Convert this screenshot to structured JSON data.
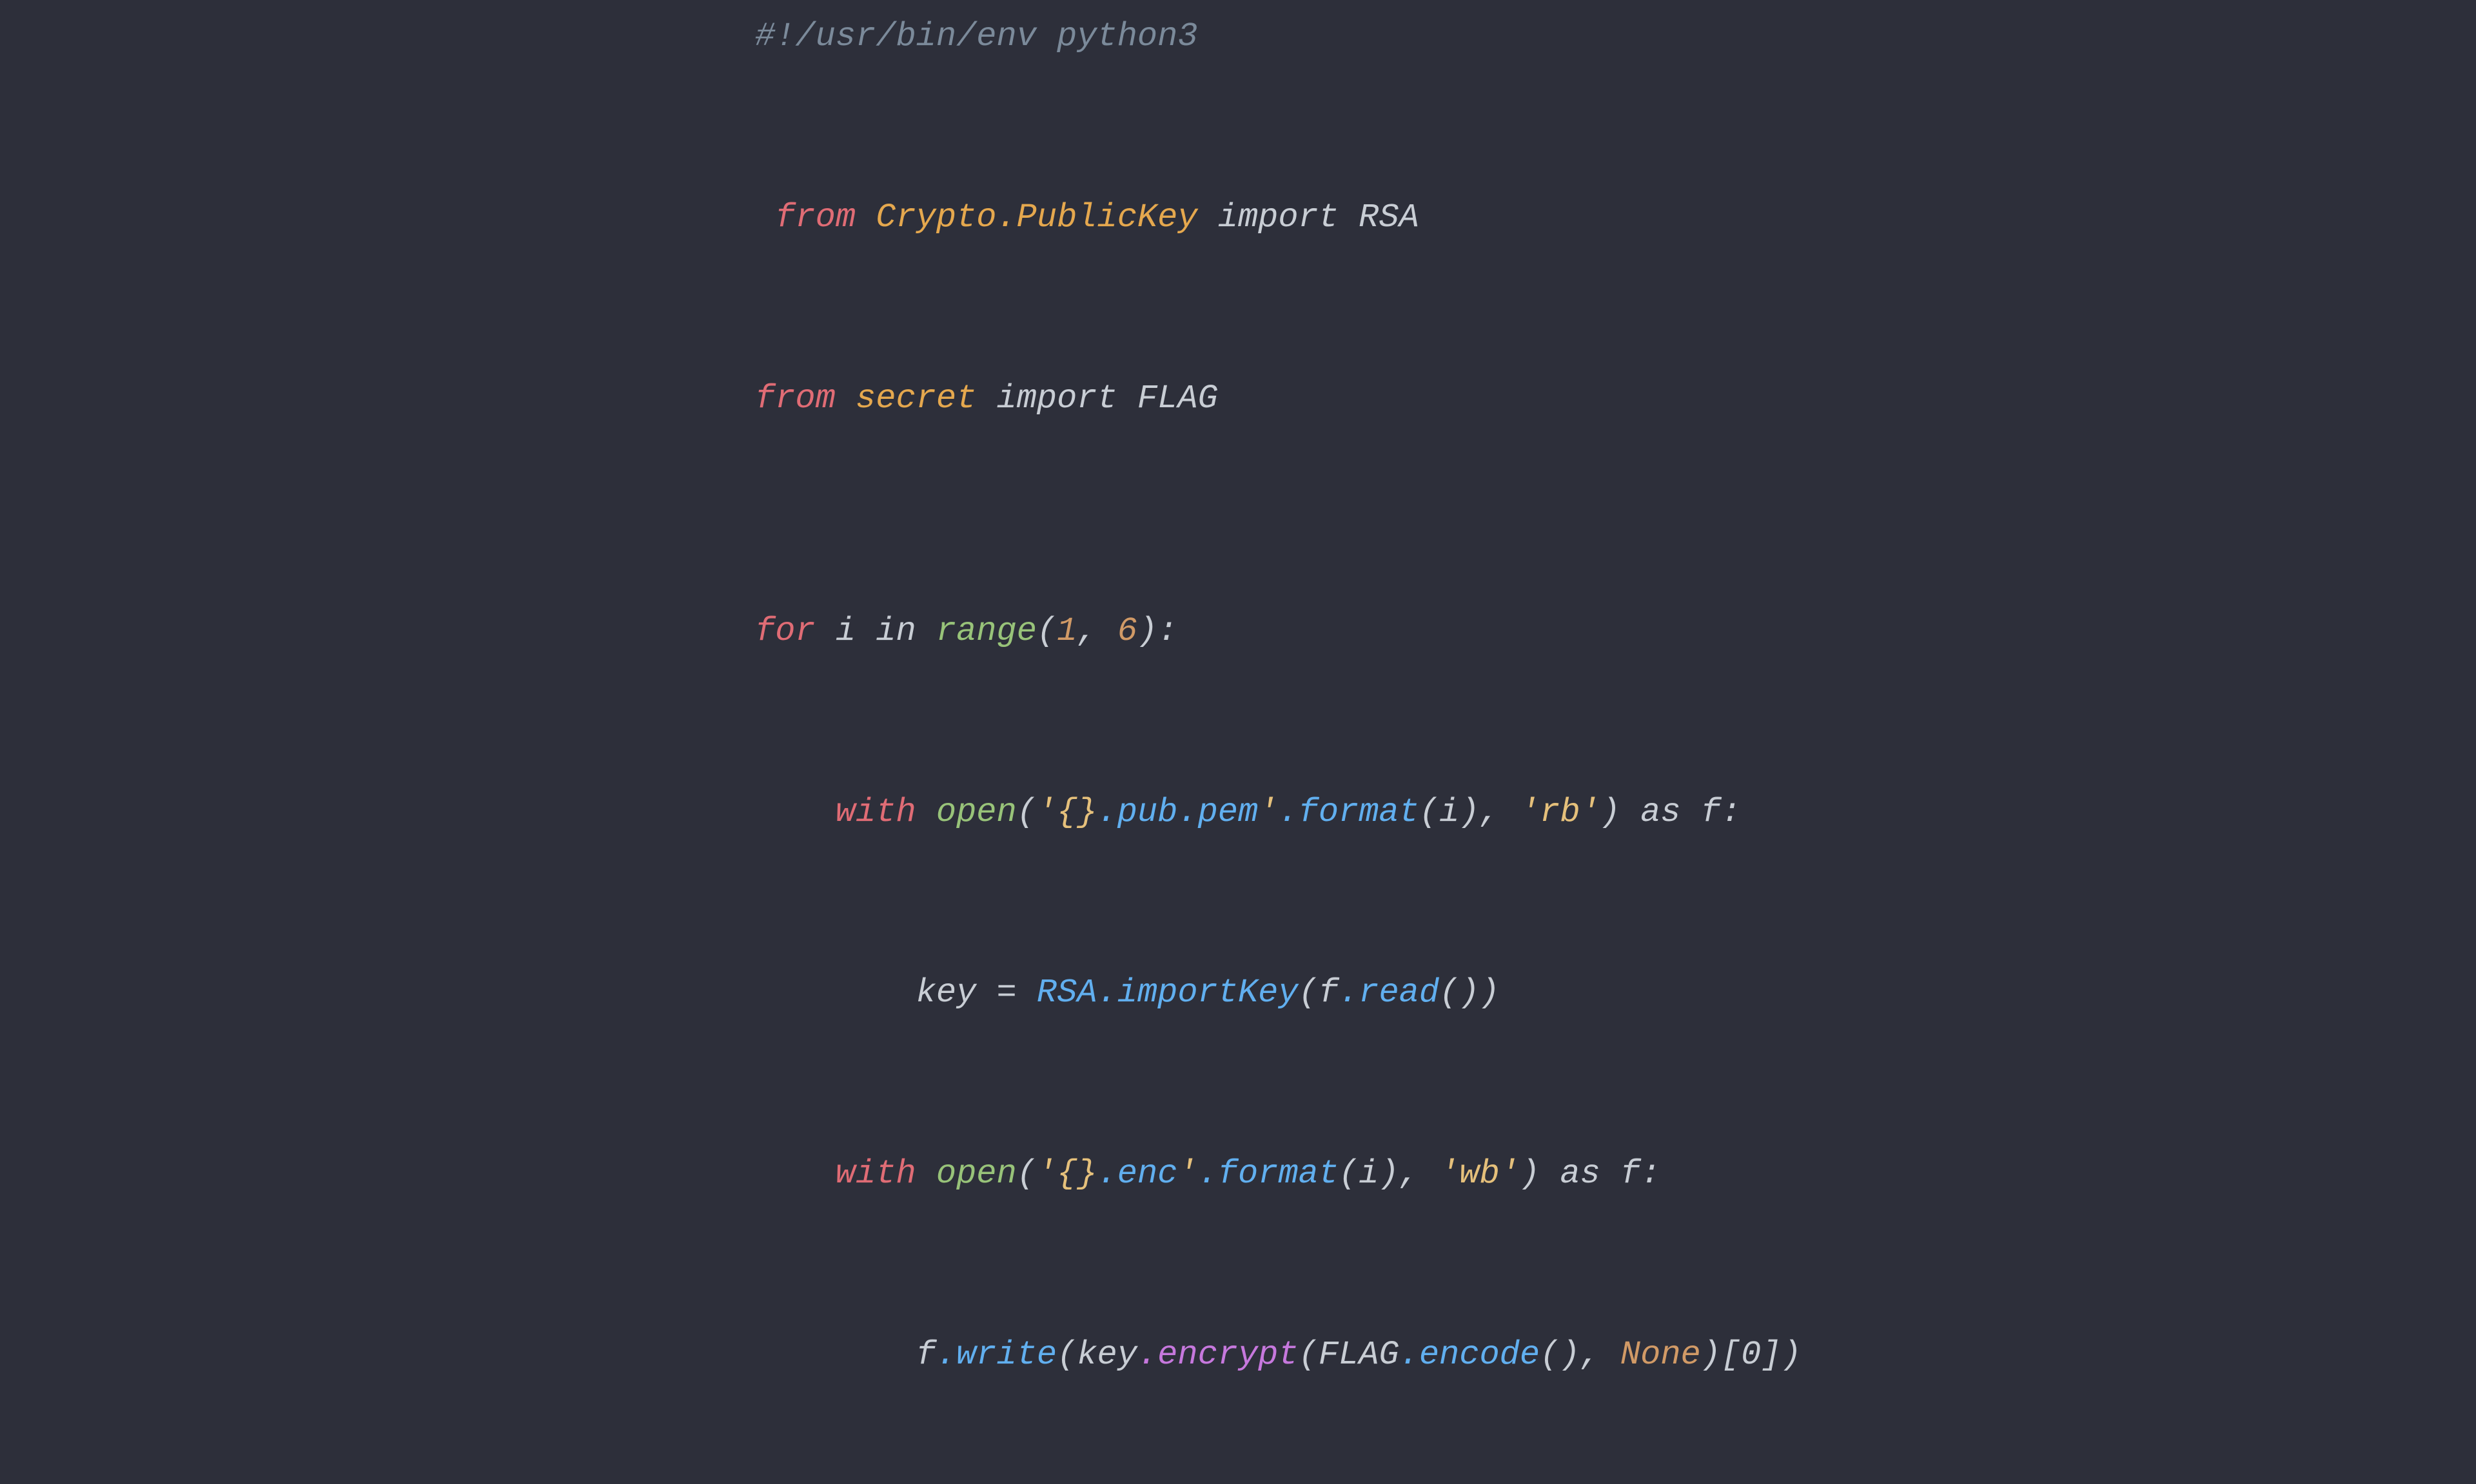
{
  "code": {
    "background": "#2d2f3a",
    "lines": [
      {
        "id": "shebang",
        "text": "#!/usr/bin/env python3",
        "type": "comment"
      },
      {
        "id": "import1",
        "text": "from Crypto.PublicKey import RSA"
      },
      {
        "id": "import2",
        "text": "from secret import FLAG"
      },
      {
        "id": "blank1",
        "type": "blank"
      },
      {
        "id": "forloop",
        "text": "for i in range(1, 6):"
      },
      {
        "id": "with1",
        "text": "    with open('{}.pub.pem'.format(i), 'rb') as f:"
      },
      {
        "id": "keyline",
        "text": "        key = RSA.importKey(f.read())"
      },
      {
        "id": "with2",
        "text": "    with open('{}.enc'.format(i), 'wb') as f:"
      },
      {
        "id": "writeline",
        "text": "        f.write(key.encrypt(FLAG.encode(), None)[0])"
      }
    ]
  }
}
